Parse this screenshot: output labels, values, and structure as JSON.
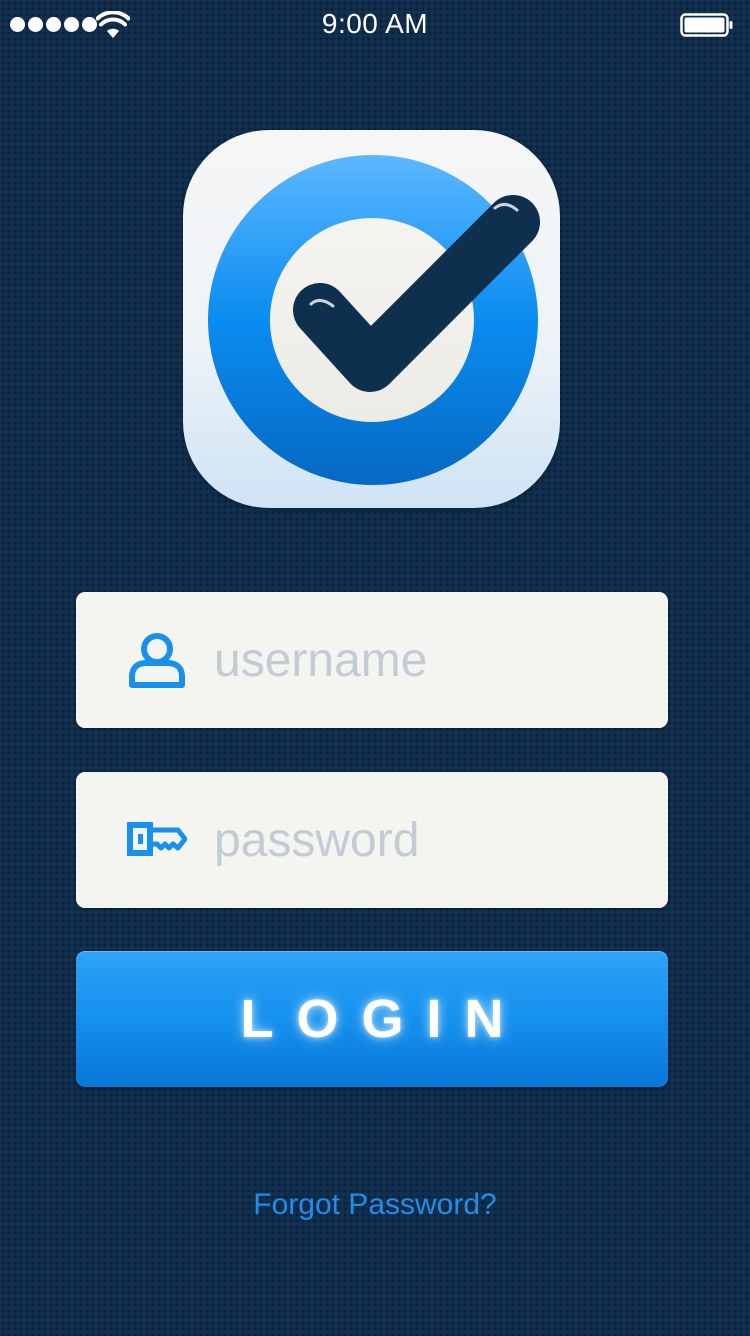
{
  "status_bar": {
    "time": "9:00 AM",
    "signal_dots": 5,
    "icons": [
      "signal-dots-icon",
      "wifi-icon",
      "battery-icon"
    ]
  },
  "logo": {
    "icon": "checkmark-target-icon"
  },
  "username": {
    "placeholder": "username",
    "value": "",
    "icon": "user-icon"
  },
  "password": {
    "placeholder": "password",
    "value": "",
    "icon": "key-icon"
  },
  "login": {
    "label": "LOGIN"
  },
  "forgot_password": {
    "label": "Forgot Password?"
  },
  "colors": {
    "background": "#0f2d4c",
    "accent": "#1590ee",
    "field_background": "#f4f4f1",
    "placeholder": "#c3ccd5",
    "link": "#1e8fe8"
  }
}
